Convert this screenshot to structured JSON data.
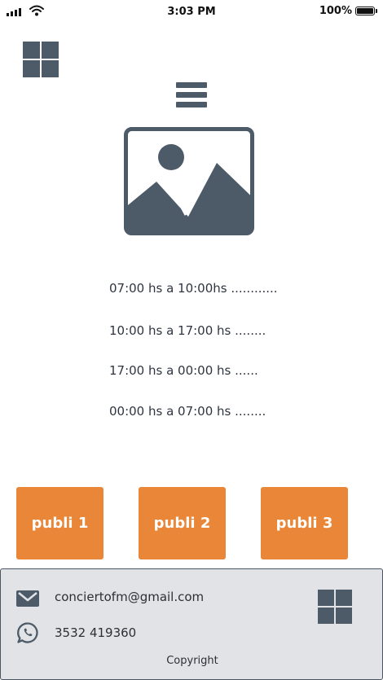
{
  "status_bar": {
    "time": "3:03 PM",
    "battery_percent": "100%"
  },
  "header": {
    "logo_icon": "grid-icon",
    "menu_icon": "hamburger-icon"
  },
  "main": {
    "image_placeholder_icon": "image-icon",
    "schedule": [
      "07:00 hs a 10:00hs ............",
      "10:00 hs a 17:00 hs ........",
      "17:00 hs a 00:00 hs ......",
      "00:00 hs a 07:00 hs ........"
    ]
  },
  "ads": [
    {
      "label": "publi 1"
    },
    {
      "label": "publi 2"
    },
    {
      "label": "publi 3"
    }
  ],
  "footer": {
    "email": "conciertofm@gmail.com",
    "phone": "3532 419360",
    "copyright": "Copyright",
    "email_icon": "envelope-icon",
    "phone_icon": "whatsapp-icon",
    "logo_icon": "grid-icon"
  },
  "colors": {
    "accent": "#ea8637",
    "icon": "#4d5b69",
    "footer_bg": "#e1e3e6"
  }
}
